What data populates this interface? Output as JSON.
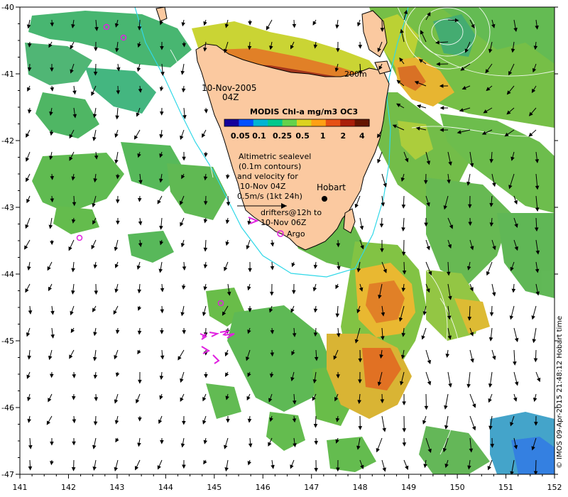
{
  "map": {
    "date_label": "10-Nov-2005",
    "time_label": "04Z",
    "colorbar": {
      "title": "MODIS Chl-a mg/m3 OC3",
      "ticks": [
        "0.05",
        "0.1",
        "0.25",
        "0.5",
        "1",
        "2",
        "4"
      ],
      "colors": [
        "#14009b",
        "#0050ff",
        "#00b4d2",
        "#00c88c",
        "#64d24b",
        "#dcd21e",
        "#ffa014",
        "#e65014",
        "#aa1e0a",
        "#641400"
      ]
    },
    "isobath_label": "200m",
    "sealevel_text": [
      "Altimetric sealevel",
      "(0.1m contours)",
      "and velocity for",
      "10-Nov 04Z",
      "0.5m/s (1kt 24h)"
    ],
    "place_label": "Hobart",
    "drifter_text": [
      "drifters@12h to",
      "10-Nov 06Z"
    ],
    "argo_label": "Argo",
    "credit": "© IMOS 09-Apr-2015 21:48:12 Hobart time",
    "x_ticks": [
      "141",
      "142",
      "143",
      "144",
      "145",
      "146",
      "147",
      "148",
      "149",
      "150",
      "151",
      "152"
    ],
    "y_ticks": [
      "-40",
      "-41",
      "-42",
      "-43",
      "-44",
      "-45",
      "-46",
      "-47"
    ],
    "lon_range": [
      141,
      152
    ],
    "lat_range": [
      -47,
      -40
    ],
    "colors": {
      "land": "#fbc9a0",
      "isobath": "#30d8e8",
      "drifter": "#e020e0",
      "argo": "#e020e0",
      "sealevel_contour": "#ffffff"
    }
  }
}
